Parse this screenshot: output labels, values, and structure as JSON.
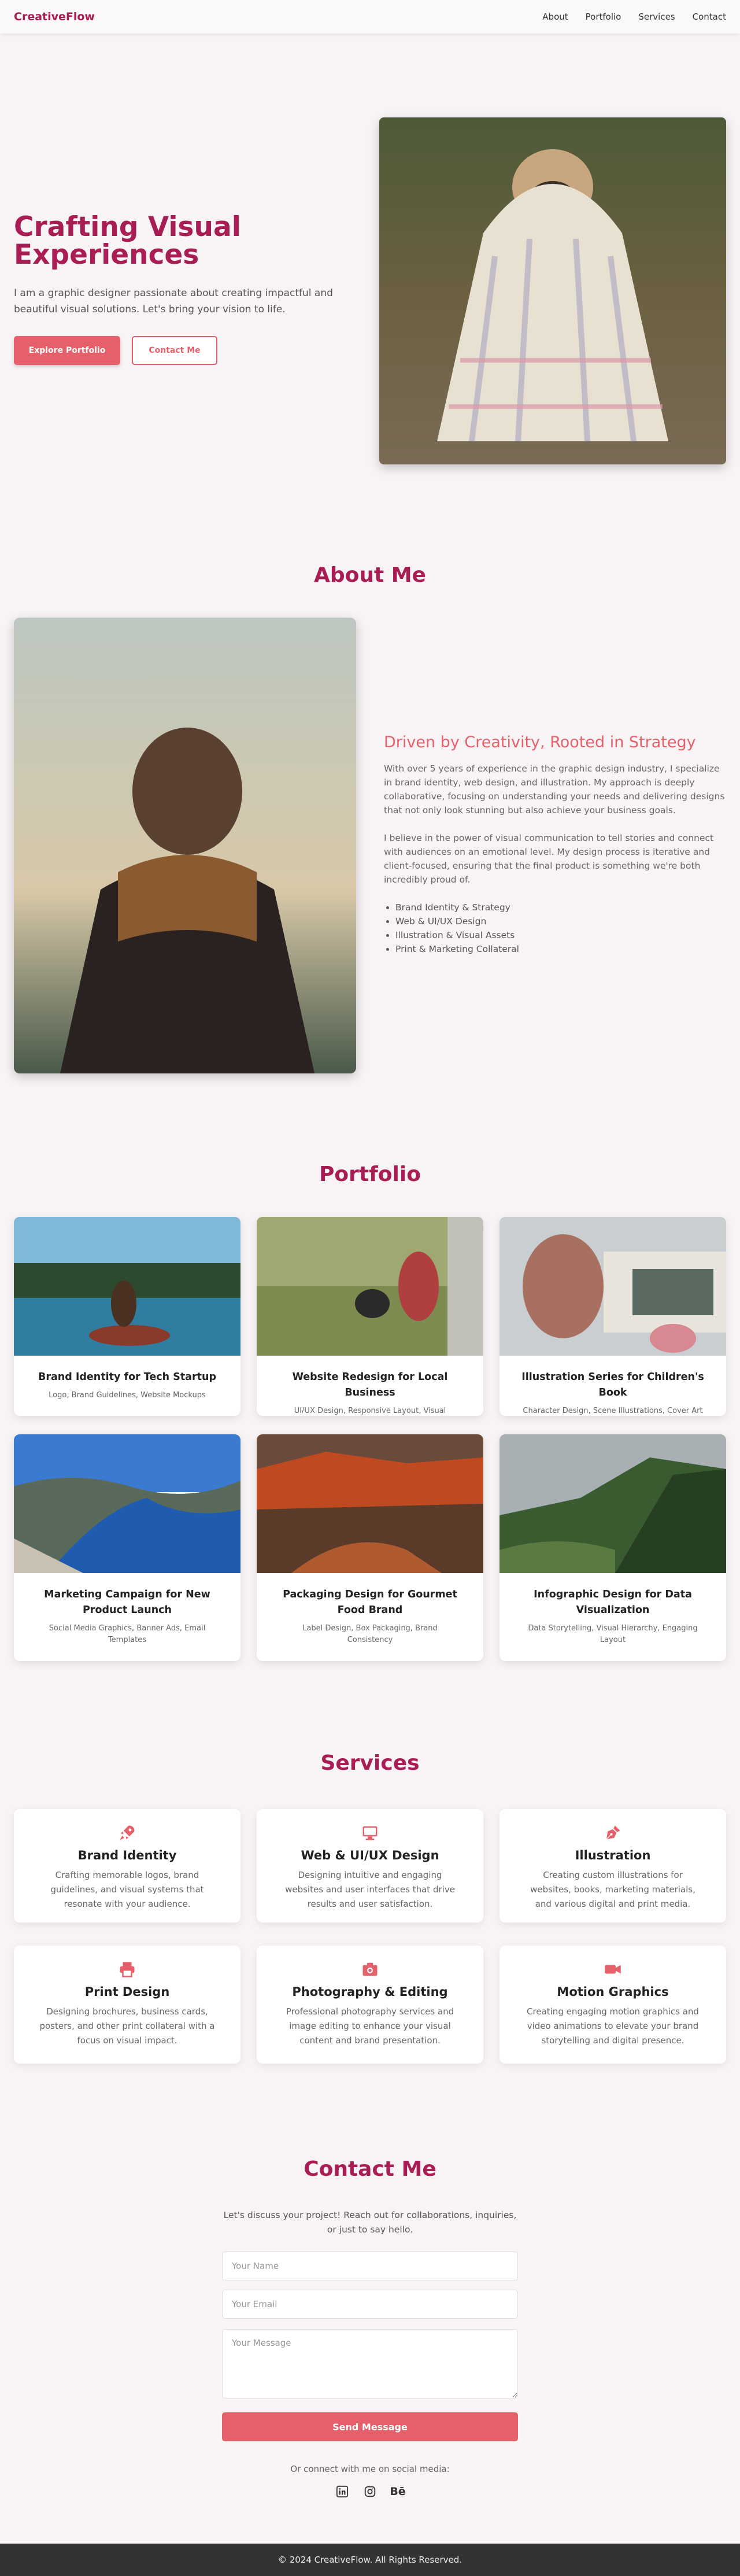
{
  "brand": "CreativeFlow",
  "nav": [
    "About",
    "Portfolio",
    "Services",
    "Contact"
  ],
  "hero": {
    "title": "Crafting Visual Experiences",
    "subtitle": "I am a graphic designer passionate about creating impactful and beautiful visual solutions. Let's bring your vision to life.",
    "primary_cta": "Explore Portfolio",
    "secondary_cta": "Contact Me"
  },
  "about": {
    "title": "About Me",
    "heading": "Driven by Creativity, Rooted in Strategy",
    "paragraphs": [
      "With over 5 years of experience in the graphic design industry, I specialize in brand identity, web design, and illustration. My approach is deeply collaborative, focusing on understanding your needs and delivering designs that not only look stunning but also achieve your business goals.",
      "I believe in the power of visual communication to tell stories and connect with audiences on an emotional level. My design process is iterative and client-focused, ensuring that the final product is something we're both incredibly proud of."
    ],
    "skills": [
      "Brand Identity & Strategy",
      "Web & UI/UX Design",
      "Illustration & Visual Assets",
      "Print & Marketing Collateral"
    ]
  },
  "portfolio": {
    "title": "Portfolio",
    "items": [
      {
        "title": "Brand Identity for Tech Startup",
        "tags": "Logo, Brand Guidelines, Website Mockups"
      },
      {
        "title": "Website Redesign for Local Business",
        "tags": "UI/UX Design, Responsive Layout, Visual Refresh"
      },
      {
        "title": "Illustration Series for Children's Book",
        "tags": "Character Design, Scene Illustrations, Cover Art"
      },
      {
        "title": "Marketing Campaign for New Product Launch",
        "tags": "Social Media Graphics, Banner Ads, Email Templates"
      },
      {
        "title": "Packaging Design for Gourmet Food Brand",
        "tags": "Label Design, Box Packaging, Brand Consistency"
      },
      {
        "title": "Infographic Design for Data Visualization",
        "tags": "Data Storytelling, Visual Hierarchy, Engaging Layout"
      }
    ]
  },
  "services": {
    "title": "Services",
    "items": [
      {
        "icon": "rocket-icon",
        "title": "Brand Identity",
        "desc": "Crafting memorable logos, brand guidelines, and visual systems that resonate with your audience."
      },
      {
        "icon": "desktop-icon",
        "title": "Web & UI/UX Design",
        "desc": "Designing intuitive and engaging websites and user interfaces that drive results and user satisfaction."
      },
      {
        "icon": "pen-nib-icon",
        "title": "Illustration",
        "desc": "Creating custom illustrations for websites, books, marketing materials, and various digital and print media."
      },
      {
        "icon": "printer-icon",
        "title": "Print Design",
        "desc": "Designing brochures, business cards, posters, and other print collateral with a focus on visual impact."
      },
      {
        "icon": "camera-icon",
        "title": "Photography & Editing",
        "desc": "Professional photography services and image editing to enhance your visual content and brand presentation."
      },
      {
        "icon": "video-icon",
        "title": "Motion Graphics",
        "desc": "Creating engaging motion graphics and video animations to elevate your brand storytelling and digital presence."
      }
    ]
  },
  "contact": {
    "title": "Contact Me",
    "intro": "Let's discuss your project! Reach out for collaborations, inquiries, or just to say hello.",
    "name_placeholder": "Your Name",
    "email_placeholder": "Your Email",
    "message_placeholder": "Your Message",
    "send_label": "Send Message",
    "social_label": "Or connect with me on social media:",
    "behance_label": "Bē"
  },
  "footer": "© 2024 CreativeFlow. All Rights Reserved.",
  "colors": {
    "brand": "#a81d54",
    "accent": "#e5606a",
    "background": "#f8f3f5"
  }
}
